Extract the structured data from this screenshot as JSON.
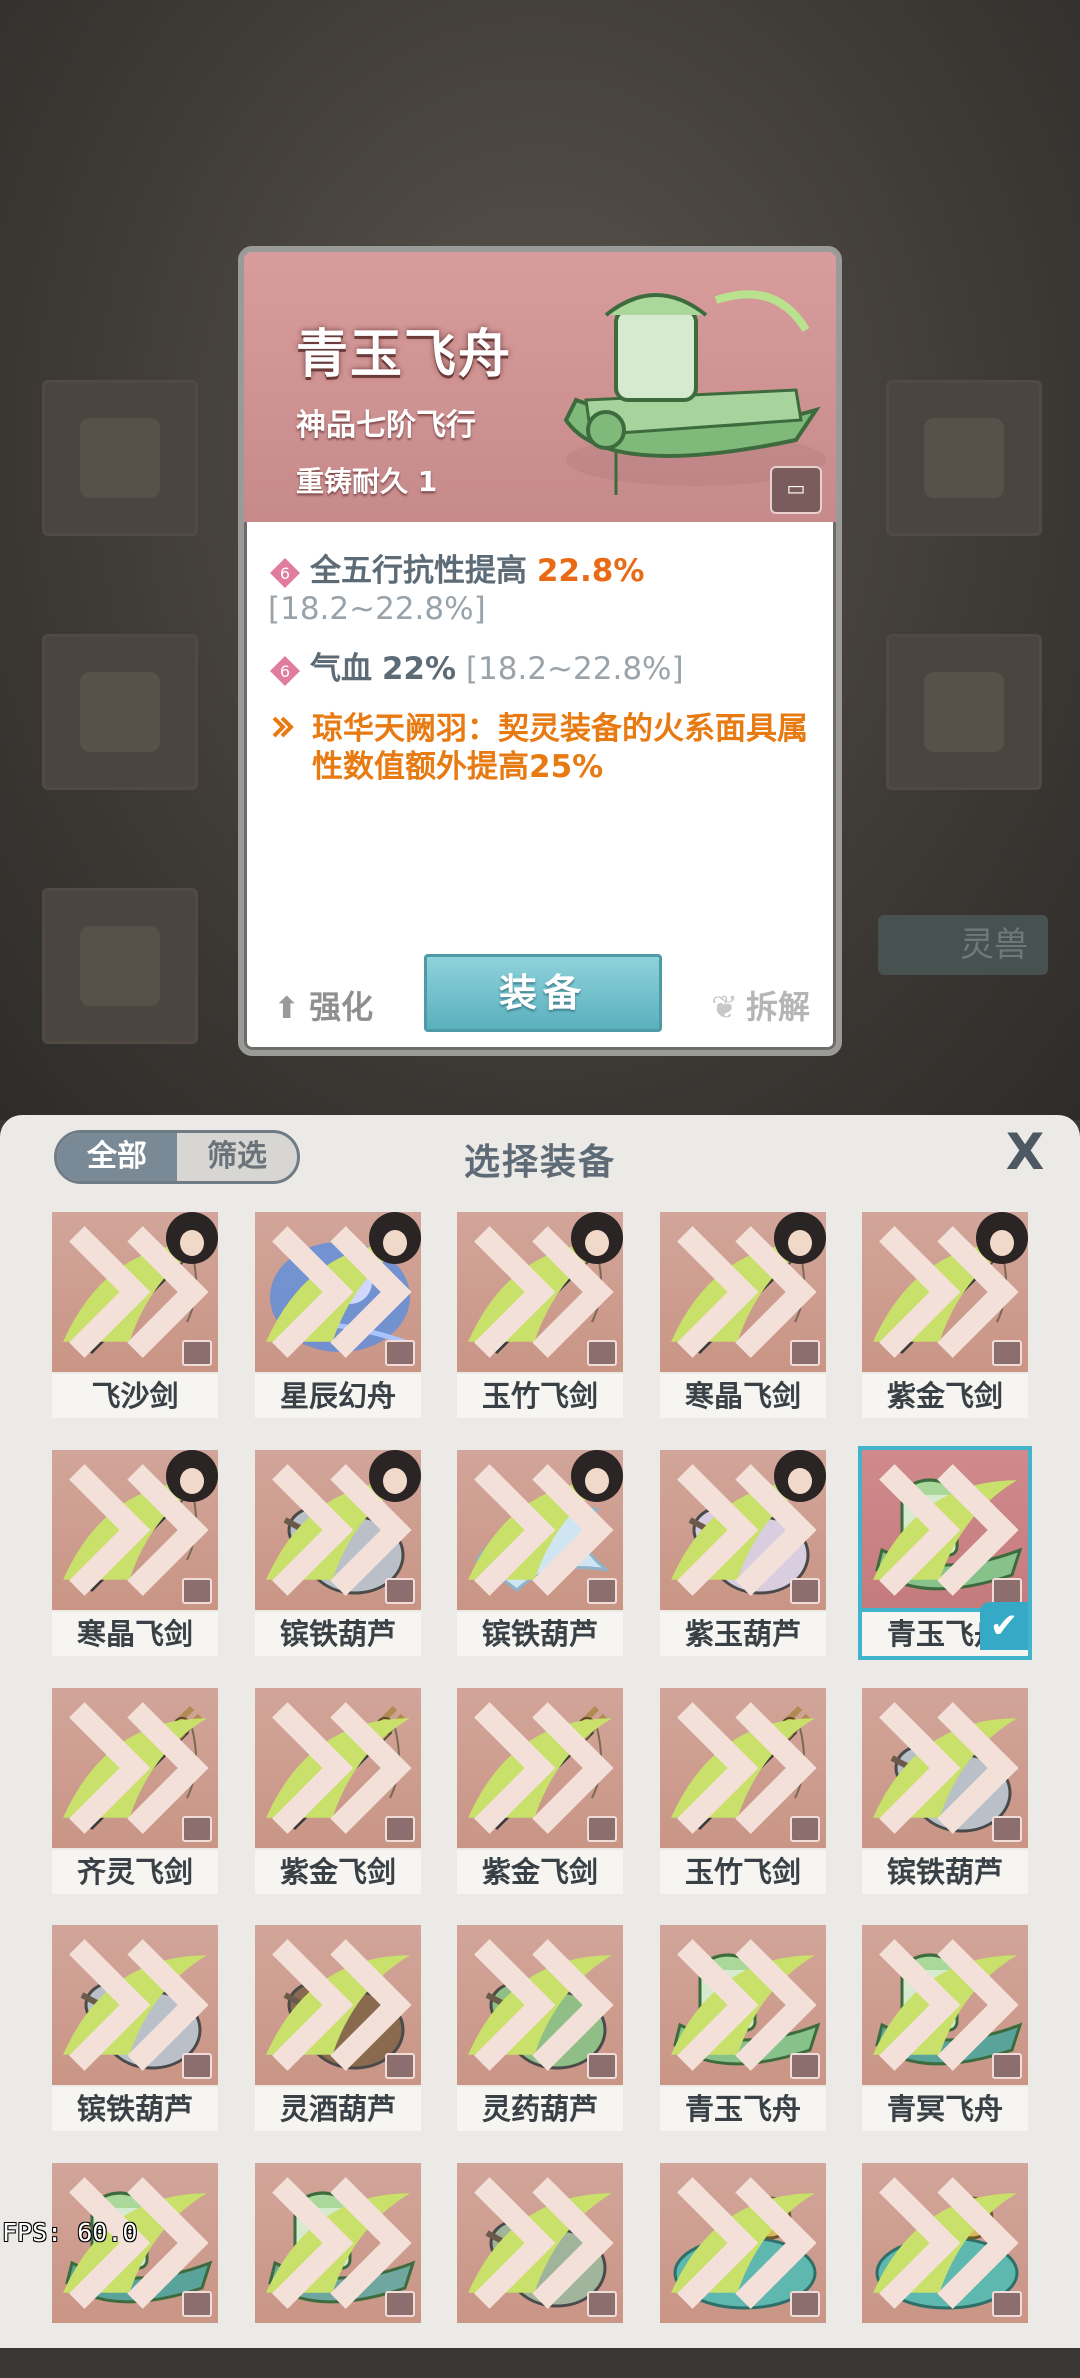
{
  "background": {
    "right_tab_label": "灵兽"
  },
  "detail": {
    "title": "青玉飞舟",
    "subtitle": "神品七阶飞行",
    "durability": "重铸耐久 1",
    "stats": [
      {
        "gem": "6",
        "name": "全五行抗性提高",
        "value": "22.8%",
        "range": "[18.2~22.8%]"
      },
      {
        "gem": "6",
        "name": "气血",
        "value": "22%",
        "range": "[18.2~22.8%]"
      }
    ],
    "special": "琼华天阙羽：契灵装备的火系面具属性数值额外提高25%",
    "upgrade_label": "强化",
    "equip_label": "装备",
    "salvage_label": "拆解"
  },
  "panel": {
    "tab_all": "全部",
    "tab_filter": "筛选",
    "title": "选择装备",
    "close_label": "X"
  },
  "items": [
    {
      "name": "飞沙剑",
      "kind": "sword",
      "color": "#8a9a7c",
      "portrait": true,
      "selected": false
    },
    {
      "name": "星辰幻舟",
      "kind": "cloud",
      "color": "#5b8ee0",
      "portrait": true,
      "selected": false
    },
    {
      "name": "玉竹飞剑",
      "kind": "sword",
      "color": "#6fbb6e",
      "portrait": true,
      "selected": false
    },
    {
      "name": "寒晶飞剑",
      "kind": "sword",
      "color": "#6fc0d0",
      "portrait": true,
      "selected": false
    },
    {
      "name": "紫金飞剑",
      "kind": "sword",
      "color": "#5b5f66",
      "portrait": true,
      "selected": false
    },
    {
      "name": "寒晶飞剑",
      "kind": "sword",
      "color": "#79c8d6",
      "portrait": true,
      "selected": false
    },
    {
      "name": "镔铁葫芦",
      "kind": "gourd",
      "color": "#b9c0c8",
      "portrait": true,
      "selected": false
    },
    {
      "name": "镔铁葫芦",
      "kind": "bird",
      "color": "#cfe6f2",
      "portrait": true,
      "selected": false
    },
    {
      "name": "紫玉葫芦",
      "kind": "gourd",
      "color": "#d9cde0",
      "portrait": true,
      "selected": false
    },
    {
      "name": "青玉飞舟",
      "kind": "boat",
      "color": "#86c28a",
      "portrait": false,
      "selected": true
    },
    {
      "name": "齐灵飞剑",
      "kind": "sword",
      "color": "#4d5157",
      "portrait": false,
      "selected": false
    },
    {
      "name": "紫金飞剑",
      "kind": "sword",
      "color": "#6d6f74",
      "portrait": false,
      "selected": false
    },
    {
      "name": "紫金飞剑",
      "kind": "sword",
      "color": "#6d6f74",
      "portrait": false,
      "selected": false
    },
    {
      "name": "玉竹飞剑",
      "kind": "sword",
      "color": "#63b566",
      "portrait": false,
      "selected": false
    },
    {
      "name": "镔铁葫芦",
      "kind": "gourd",
      "color": "#b9c0c8",
      "portrait": false,
      "selected": false
    },
    {
      "name": "镔铁葫芦",
      "kind": "gourd",
      "color": "#b9c0c8",
      "portrait": false,
      "selected": false
    },
    {
      "name": "灵酒葫芦",
      "kind": "gourd",
      "color": "#8a6a4e",
      "portrait": false,
      "selected": false
    },
    {
      "name": "灵药葫芦",
      "kind": "gourd",
      "color": "#8fbf86",
      "portrait": false,
      "selected": false
    },
    {
      "name": "青玉飞舟",
      "kind": "boat",
      "color": "#86c28a",
      "portrait": false,
      "selected": false
    },
    {
      "name": "青冥飞舟",
      "kind": "boat",
      "color": "#5aa39a",
      "portrait": false,
      "selected": false
    },
    {
      "name": "",
      "kind": "boat",
      "color": "#5aa39a",
      "portrait": false,
      "selected": false
    },
    {
      "name": "",
      "kind": "boat",
      "color": "#6fa6a0",
      "portrait": false,
      "selected": false
    },
    {
      "name": "",
      "kind": "gourd",
      "color": "#9fb49a",
      "portrait": false,
      "selected": false
    },
    {
      "name": "",
      "kind": "lotus",
      "color": "#5fb8b0",
      "portrait": false,
      "selected": false
    },
    {
      "name": "",
      "kind": "lotus",
      "color": "#5fb8b0",
      "portrait": false,
      "selected": false
    }
  ],
  "fps": "FPS: 60.0",
  "colors": {
    "accent": "#41b3cc",
    "stat_value": "#e86a14",
    "special": "#e87a12",
    "card_header": "#d89c9c"
  }
}
